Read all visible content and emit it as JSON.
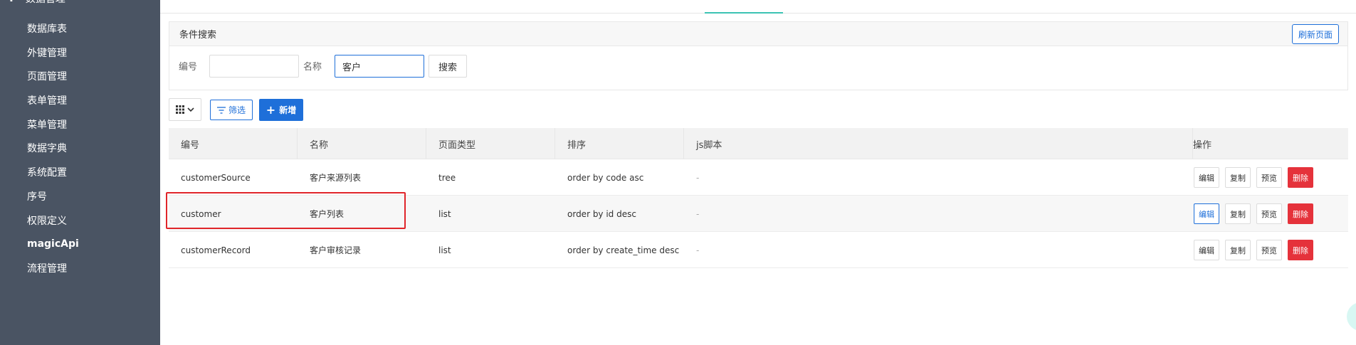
{
  "sidebar": {
    "top_label": "数据管理",
    "items": [
      {
        "label": "数据库表"
      },
      {
        "label": "外键管理"
      },
      {
        "label": "页面管理"
      },
      {
        "label": "表单管理"
      },
      {
        "label": "菜单管理"
      },
      {
        "label": "数据字典"
      },
      {
        "label": "系统配置"
      },
      {
        "label": "序号"
      },
      {
        "label": "权限定义"
      },
      {
        "label": "magicApi"
      },
      {
        "label": "流程管理"
      }
    ]
  },
  "search": {
    "title": "条件搜索",
    "refresh_label": "刷新页面",
    "code_label": "编号",
    "code_value": "",
    "name_label": "名称",
    "name_value": "客户",
    "search_label": "搜索"
  },
  "toolbar": {
    "filter_label": "筛选",
    "add_label": "新增"
  },
  "table": {
    "headers": [
      "编号",
      "名称",
      "页面类型",
      "排序",
      "js脚本",
      "操作"
    ],
    "rows": [
      {
        "code": "customerSource",
        "name": "客户来源列表",
        "type": "tree",
        "order": "order by code asc",
        "js": "-"
      },
      {
        "code": "customer",
        "name": "客户列表",
        "type": "list",
        "order": "order by id desc",
        "js": "-"
      },
      {
        "code": "customerRecord",
        "name": "客户审核记录",
        "type": "list",
        "order": "order by create_time desc",
        "js": "-"
      }
    ],
    "actions": {
      "edit": "编辑",
      "copy": "复制",
      "preview": "预览",
      "delete": "删除"
    }
  },
  "colors": {
    "sidebar_bg": "#4a5463",
    "primary": "#1e6fd9",
    "danger": "#e5323b",
    "tab_active": "#3cc3b3",
    "highlight": "#e0252a"
  }
}
